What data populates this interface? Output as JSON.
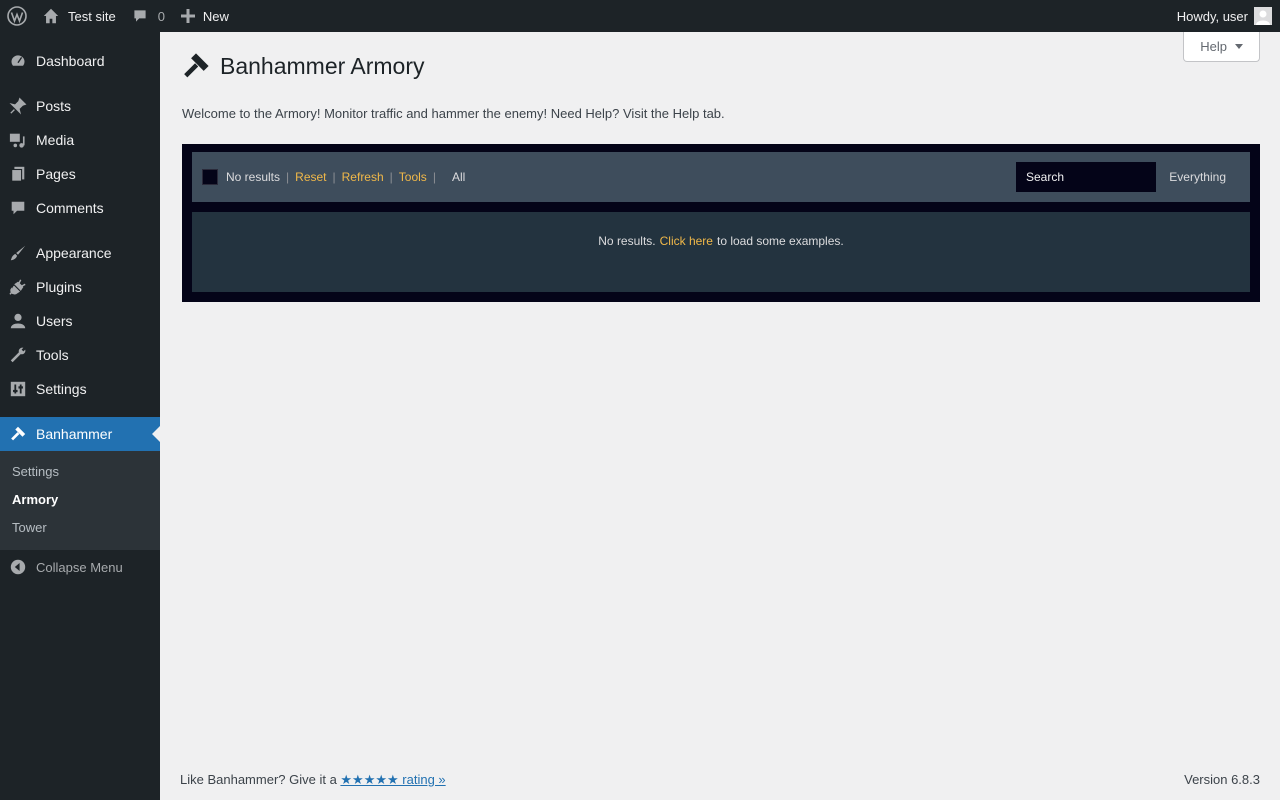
{
  "adminbar": {
    "site_name": "Test site",
    "comments_count": "0",
    "new_label": "New",
    "howdy": "Howdy, user"
  },
  "sidebar": {
    "items": [
      {
        "label": "Dashboard",
        "icon": "dashboard-icon"
      },
      {
        "label": "Posts",
        "icon": "pushpin-icon"
      },
      {
        "label": "Media",
        "icon": "media-icon"
      },
      {
        "label": "Pages",
        "icon": "pages-icon"
      },
      {
        "label": "Comments",
        "icon": "comment-icon"
      },
      {
        "label": "Appearance",
        "icon": "paintbrush-icon"
      },
      {
        "label": "Plugins",
        "icon": "plug-icon"
      },
      {
        "label": "Users",
        "icon": "user-icon"
      },
      {
        "label": "Tools",
        "icon": "wrench-icon"
      },
      {
        "label": "Settings",
        "icon": "settings-icon"
      },
      {
        "label": "Banhammer",
        "icon": "hammer-icon"
      }
    ],
    "submenu": [
      "Settings",
      "Armory",
      "Tower"
    ],
    "collapse_label": "Collapse Menu"
  },
  "main": {
    "help_label": "Help",
    "title": "Banhammer Armory",
    "intro": "Welcome to the Armory! Monitor traffic and hammer the enemy! Need Help? Visit the Help tab.",
    "toolbar": {
      "count_text": "No results",
      "reset": "Reset",
      "refresh": "Refresh",
      "tools": "Tools",
      "all": "All",
      "search_placeholder": "Search",
      "everything": "Everything"
    },
    "results": {
      "prefix": "No results.",
      "link": "Click here",
      "suffix": "to load some examples."
    }
  },
  "footer": {
    "left_text": "Like Banhammer? Give it a ",
    "rating_link": "★★★★★ rating »",
    "version": "Version 6.8.3"
  },
  "colors": {
    "adminbar_bg": "#1d2327",
    "accent": "#2271b1",
    "link_orange": "#f0b849",
    "armory_bg": "#040418"
  }
}
